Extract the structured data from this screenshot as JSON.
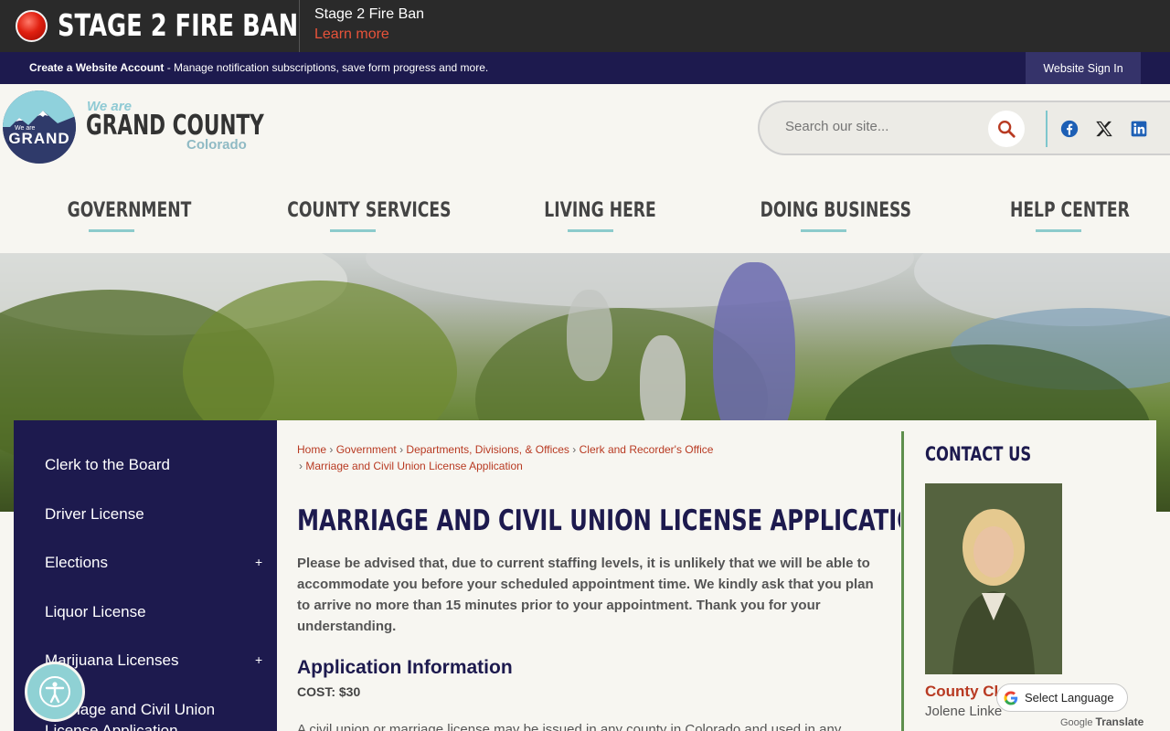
{
  "alert": {
    "title": "STAGE 2 FIRE BAN",
    "message": "Stage 2 Fire Ban",
    "link": "Learn more"
  },
  "account_bar": {
    "create_label": "Create a Website Account",
    "create_desc": " - Manage notification subscriptions, save form progress and more.",
    "sign_in": "Website Sign In"
  },
  "logo": {
    "we_are": "We are",
    "county": "GRAND COUNTY",
    "state": "Colorado",
    "badge_small": "We are",
    "badge_word": "GRAND"
  },
  "search": {
    "placeholder": "Search our site..."
  },
  "social": [
    "facebook-icon",
    "x-icon",
    "linkedin-icon"
  ],
  "nav": {
    "items": [
      {
        "label": "GOVERNMENT"
      },
      {
        "label": "COUNTY SERVICES"
      },
      {
        "label": "LIVING HERE"
      },
      {
        "label": "DOING BUSINESS"
      },
      {
        "label": "HELP CENTER"
      }
    ]
  },
  "sidebar": {
    "items": [
      {
        "label": "Clerk to the Board",
        "expandable": false
      },
      {
        "label": "Driver License",
        "expandable": false
      },
      {
        "label": "Elections",
        "expandable": true
      },
      {
        "label": "Liquor License",
        "expandable": false
      },
      {
        "label": "Marijuana Licenses",
        "expandable": true
      },
      {
        "label": "Marriage and Civil Union",
        "expandable": false
      },
      {
        "label": "License Application",
        "expandable": false
      }
    ],
    "expand_symbol": "+"
  },
  "breadcrumb": {
    "items": [
      "Home",
      "Government",
      "Departments, Divisions, & Offices",
      "Clerk and Recorder's Office",
      "Marriage and Civil Union License Application"
    ],
    "separator": "›"
  },
  "main": {
    "title": "MARRIAGE AND CIVIL UNION LICENSE APPLICATION",
    "notice": "Please be advised that, due to current staffing levels, it is unlikely that we will be able to accommodate you before your scheduled appointment time. We kindly ask that you plan to arrive no more than 15 minutes prior to your appointment. Thank you for your understanding.",
    "section_heading": "Application Information",
    "cost": "COST: $30",
    "body_start": "A civil union or marriage license may be issued in any county in Colorado and used in any"
  },
  "contact": {
    "title": "CONTACT US",
    "role": "County Clerk",
    "name": "Jolene Linke"
  },
  "translate": {
    "label": "Select Language",
    "powered_by": "Google",
    "translate_word": "Translate"
  }
}
